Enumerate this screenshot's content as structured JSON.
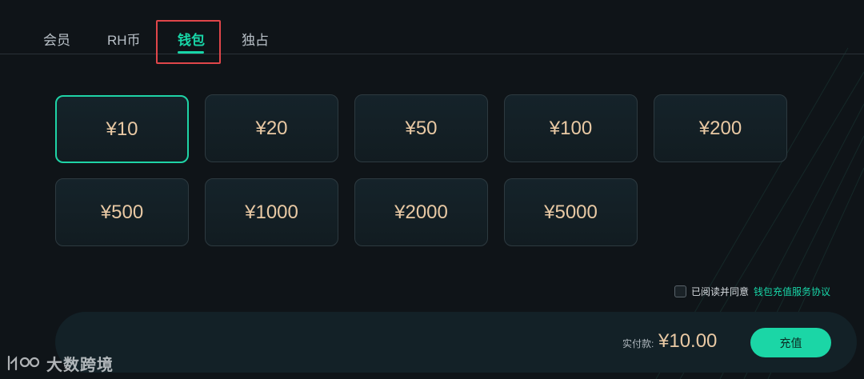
{
  "tabs": [
    {
      "label": "会员"
    },
    {
      "label": "RH币"
    },
    {
      "label": "钱包"
    },
    {
      "label": "独占"
    }
  ],
  "amounts": [
    {
      "label": "¥10"
    },
    {
      "label": "¥20"
    },
    {
      "label": "¥50"
    },
    {
      "label": "¥100"
    },
    {
      "label": "¥200"
    },
    {
      "label": "¥500"
    },
    {
      "label": "¥1000"
    },
    {
      "label": "¥2000"
    },
    {
      "label": "¥5000"
    }
  ],
  "selected_amount": "¥10",
  "agreement": {
    "text": "已阅读并同意",
    "link": "钱包充值服务协议",
    "checked": false
  },
  "payment": {
    "label": "实付款:",
    "amount": "¥10.00",
    "button": "充值"
  },
  "watermark": {
    "text": "大数跨境"
  },
  "colors": {
    "accent": "#18d6a8",
    "amount_text": "#e9c9a4",
    "background": "#0f1418",
    "highlight": "#e0464a"
  }
}
